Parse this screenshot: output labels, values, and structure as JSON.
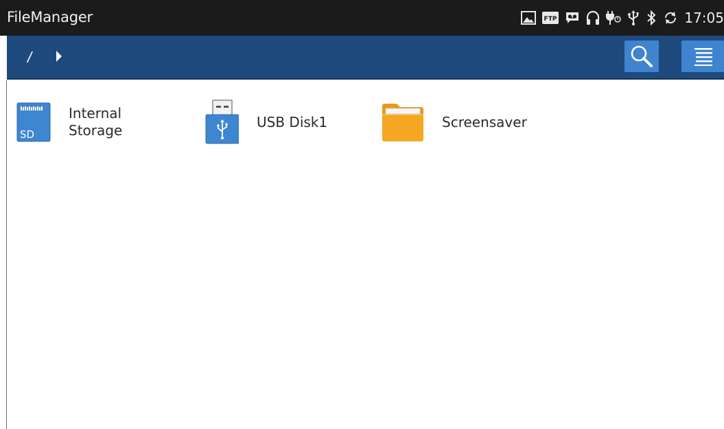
{
  "status_bar": {
    "app_title": "FileManager",
    "icons": [
      "gallery-icon",
      "ftp-icon",
      "voicemail-icon",
      "headset-icon",
      "charging-icon",
      "usb-icon",
      "bluetooth-icon",
      "sync-icon"
    ],
    "ftp_label": "FTP",
    "time": "17:05"
  },
  "toolbar": {
    "breadcrumb_root": "/",
    "color": "#1e4a7d",
    "button_color": "#3f84cf"
  },
  "items": [
    {
      "label": "Internal Storage",
      "icon": "sd-card-icon",
      "sd_text": "SD"
    },
    {
      "label": "USB Disk1",
      "icon": "usb-disk-icon"
    },
    {
      "label": "Screensaver",
      "icon": "folder-icon"
    }
  ]
}
